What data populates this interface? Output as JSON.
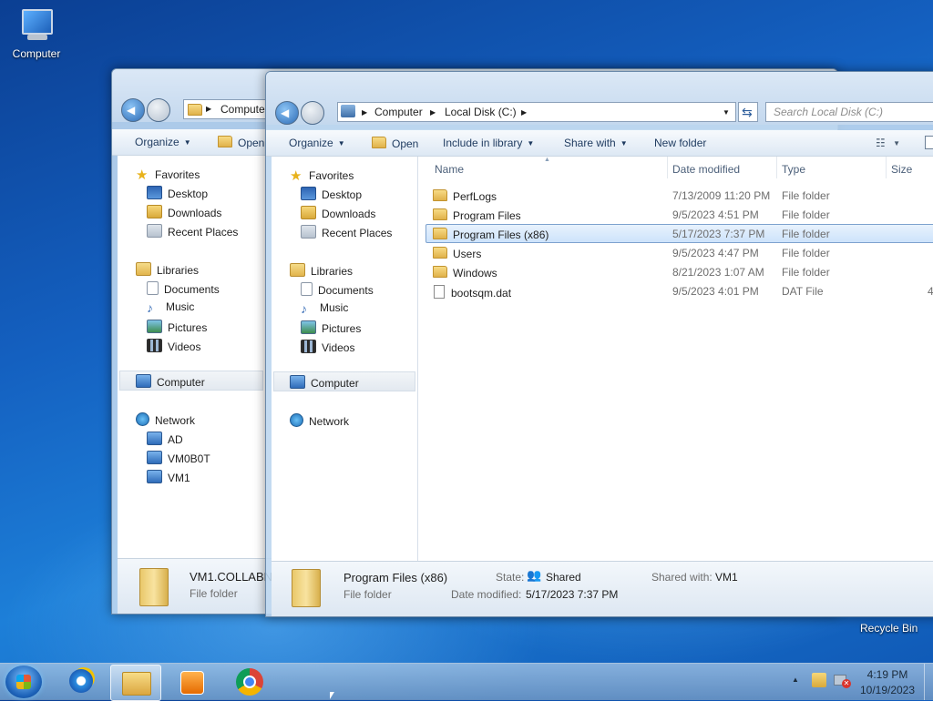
{
  "desktop": {
    "computer_label": "Computer",
    "recycle_label": "Recycle Bin"
  },
  "back_window": {
    "address": "Compute",
    "commands": [
      "Organize",
      "Open"
    ],
    "nav": {
      "favorites": "Favorites",
      "fav_items": [
        "Desktop",
        "Downloads",
        "Recent Places"
      ],
      "libraries": "Libraries",
      "lib_items": [
        "Documents",
        "Music",
        "Pictures",
        "Videos"
      ],
      "computer": "Computer",
      "network": "Network",
      "net_items": [
        "AD",
        "VM0B0T",
        "VM1"
      ]
    },
    "details": {
      "name": "VM1.COLLABN",
      "type": "File folder"
    }
  },
  "front_window": {
    "address": {
      "root": "Computer",
      "location": "Local Disk (C:)"
    },
    "search_placeholder": "Search Local Disk (C:)",
    "commands": {
      "organize": "Organize",
      "open": "Open",
      "include": "Include in library",
      "share": "Share with",
      "new_folder": "New folder"
    },
    "nav": {
      "favorites": "Favorites",
      "fav_items": [
        "Desktop",
        "Downloads",
        "Recent Places"
      ],
      "libraries": "Libraries",
      "lib_items": [
        "Documents",
        "Music",
        "Pictures",
        "Videos"
      ],
      "computer": "Computer",
      "network": "Network"
    },
    "columns": {
      "name": "Name",
      "date": "Date modified",
      "type": "Type",
      "size": "Size"
    },
    "files": [
      {
        "name": "PerfLogs",
        "date": "7/13/2009 11:20 PM",
        "type": "File folder",
        "size": ""
      },
      {
        "name": "Program Files",
        "date": "9/5/2023 4:51 PM",
        "type": "File folder",
        "size": ""
      },
      {
        "name": "Program Files (x86)",
        "date": "5/17/2023 7:37 PM",
        "type": "File folder",
        "size": ""
      },
      {
        "name": "Users",
        "date": "9/5/2023 4:47 PM",
        "type": "File folder",
        "size": ""
      },
      {
        "name": "Windows",
        "date": "8/21/2023 1:07 AM",
        "type": "File folder",
        "size": ""
      },
      {
        "name": "bootsqm.dat",
        "date": "9/5/2023 4:01 PM",
        "type": "DAT File",
        "size": "4"
      }
    ],
    "details": {
      "name": "Program Files (x86)",
      "type": "File folder",
      "state_label": "State:",
      "state_value": "Shared",
      "modified_label": "Date modified:",
      "modified_value": "5/17/2023 7:37 PM",
      "shared_label": "Shared with:",
      "shared_value": "VM1"
    }
  },
  "taskbar": {
    "time": "4:19 PM",
    "date": "10/19/2023",
    "tray_chevron": "▲"
  }
}
